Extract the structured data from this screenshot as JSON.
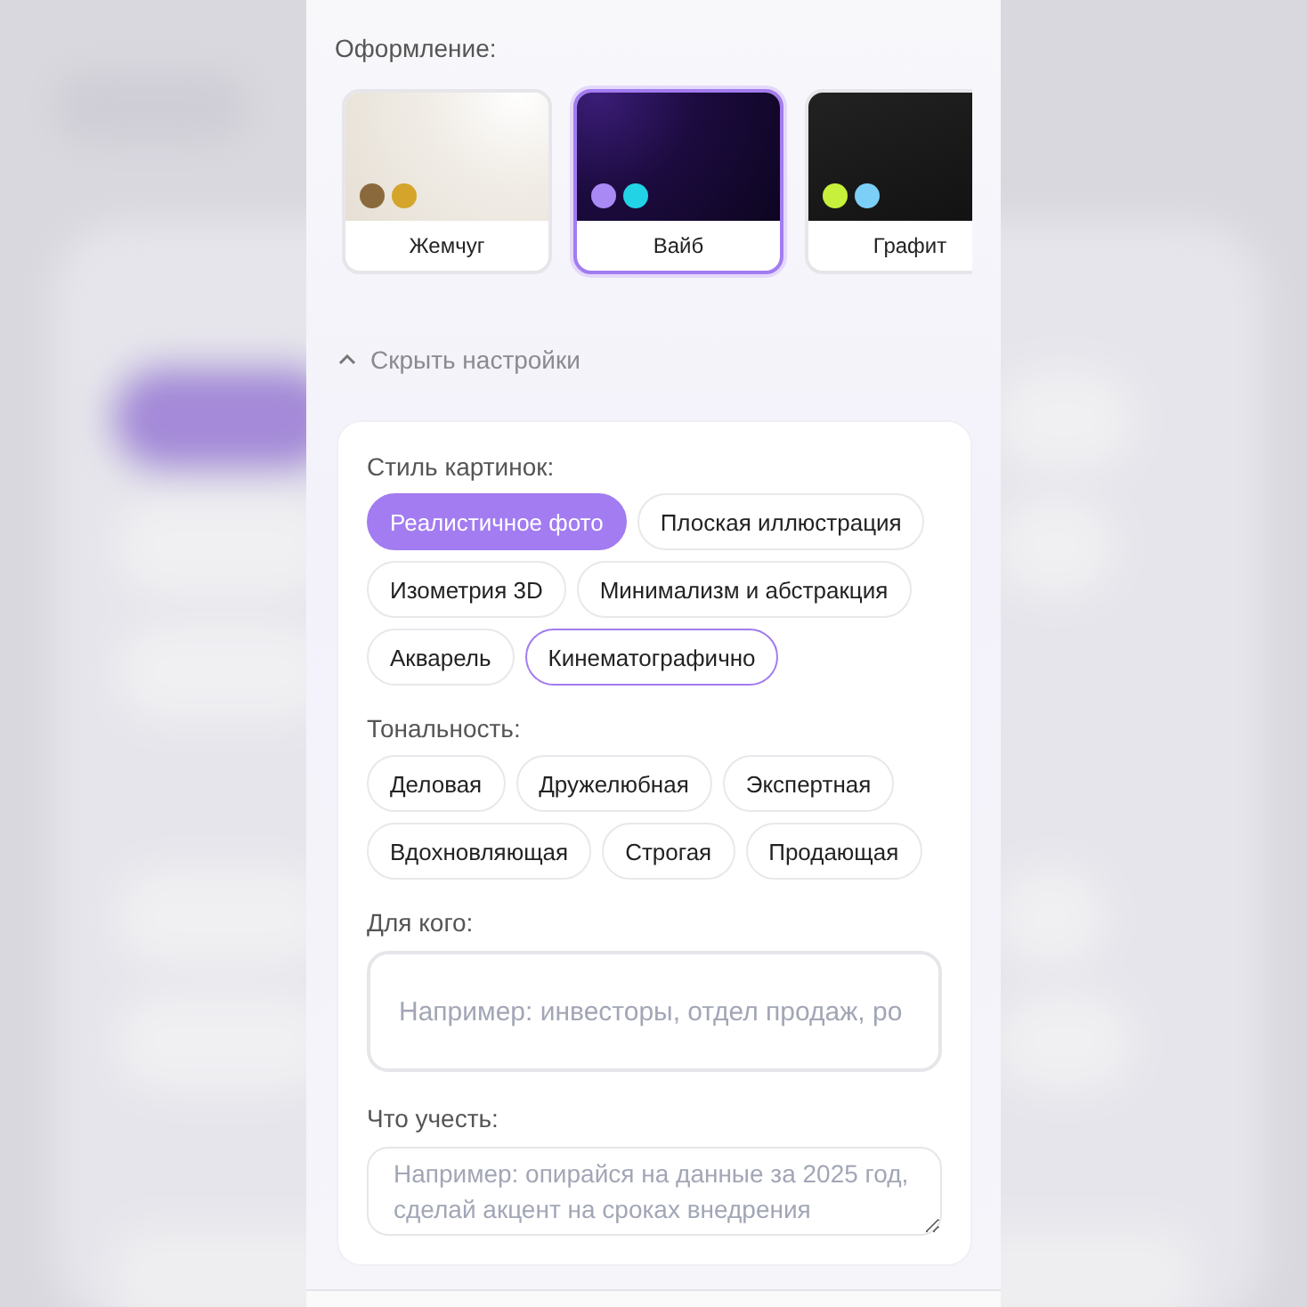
{
  "design": {
    "label": "Оформление:",
    "themes": [
      {
        "name": "Жемчуг",
        "kind": "pearl",
        "selected": false,
        "dots": [
          {
            "color": "#8a6a3c"
          },
          {
            "color": "#d4a52a"
          }
        ]
      },
      {
        "name": "Вайб",
        "kind": "vibe",
        "selected": true,
        "dots": [
          {
            "color": "#a98af5"
          },
          {
            "color": "#22d3e6"
          }
        ]
      },
      {
        "name": "Графит",
        "kind": "graphite",
        "selected": false,
        "dots": [
          {
            "color": "#c6f03c"
          },
          {
            "color": "#7ccff7"
          }
        ]
      }
    ]
  },
  "toggle": {
    "label": "Скрыть настройки",
    "expanded": true
  },
  "settings": {
    "groups": [
      {
        "label": "Стиль картинок:",
        "chips": [
          {
            "label": "Реалистичное фото",
            "selected": true,
            "focused": false
          },
          {
            "label": "Плоская иллюстрация",
            "selected": false,
            "focused": false
          },
          {
            "label": "Изометрия 3D",
            "selected": false,
            "focused": false
          },
          {
            "label": "Минимализм и абстракция",
            "selected": false,
            "focused": false
          },
          {
            "label": "Акварель",
            "selected": false,
            "focused": false
          },
          {
            "label": "Кинематографично",
            "selected": false,
            "focused": true
          }
        ]
      },
      {
        "label": "Тональность:",
        "chips": [
          {
            "label": "Деловая",
            "selected": false,
            "focused": false
          },
          {
            "label": "Дружелюбная",
            "selected": false,
            "focused": false
          },
          {
            "label": "Экспертная",
            "selected": false,
            "focused": false
          },
          {
            "label": "Вдохновляющая",
            "selected": false,
            "focused": false
          },
          {
            "label": "Строгая",
            "selected": false,
            "focused": false
          },
          {
            "label": "Продающая",
            "selected": false,
            "focused": false
          }
        ]
      }
    ],
    "audience": {
      "label": "Для кого:",
      "placeholder": "Например: инвесторы, отдел продаж, ро"
    },
    "notes": {
      "label": "Что учесть:",
      "placeholder": "Например: опирайся на данные за 2025 год, сделай акцент на сроках внедрения"
    }
  }
}
